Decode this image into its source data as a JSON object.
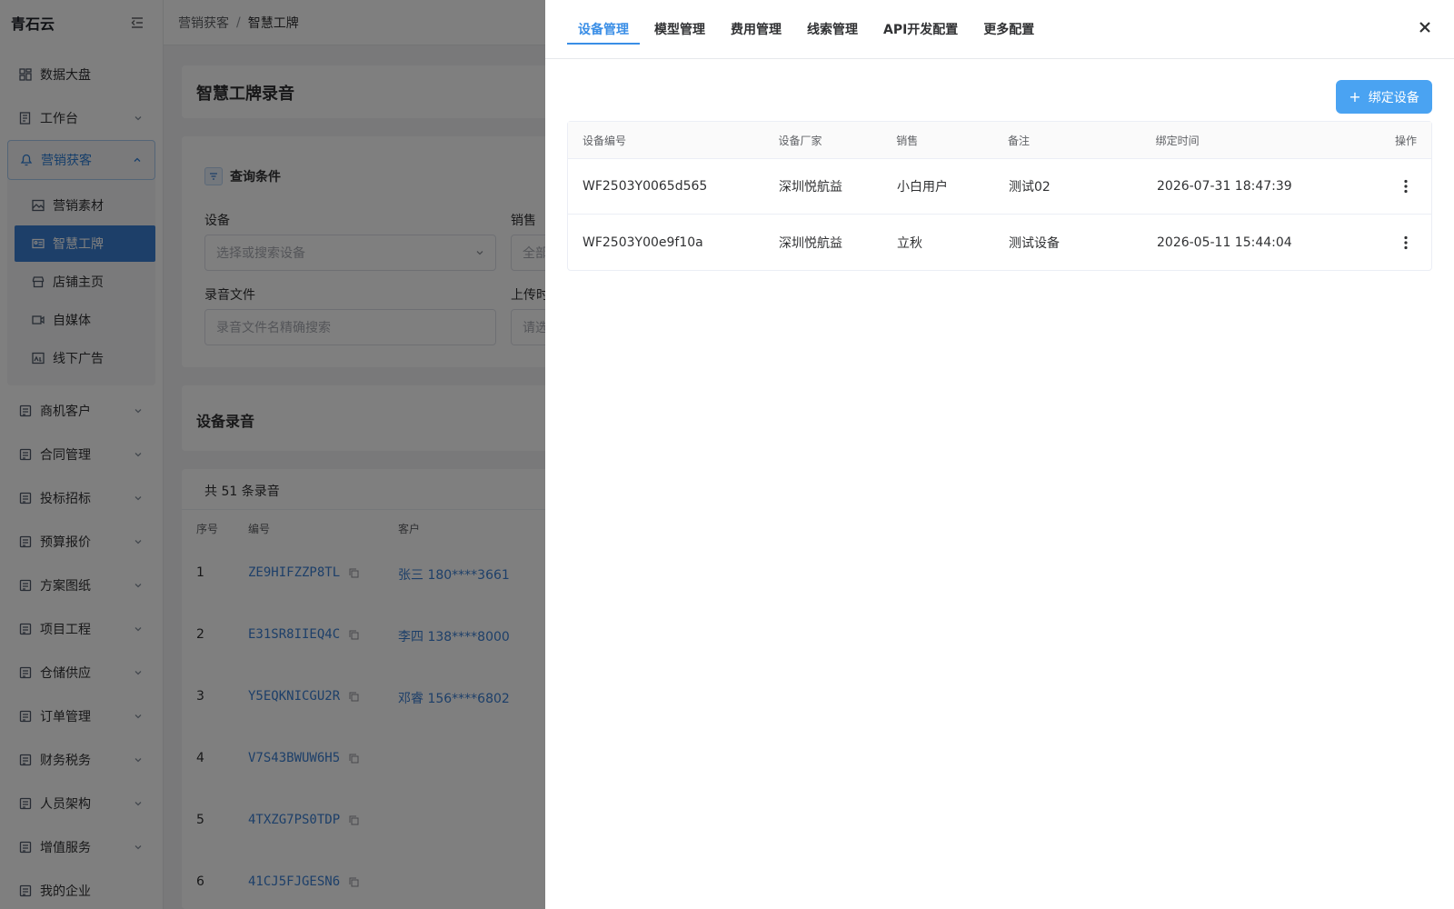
{
  "app": {
    "brand": "青石云"
  },
  "sidebar": {
    "items_top": [
      {
        "label": "数据大盘",
        "icon": "dashboard-icon"
      },
      {
        "label": "工作台",
        "icon": "workbench-icon"
      }
    ],
    "group": {
      "label": "营销获客",
      "icon": "marketing-icon",
      "children": [
        {
          "label": "营销素材",
          "icon": "image-icon"
        },
        {
          "label": "智慧工牌",
          "icon": "badge-icon"
        },
        {
          "label": "店铺主页",
          "icon": "store-icon"
        },
        {
          "label": "自媒体",
          "icon": "video-icon"
        },
        {
          "label": "线下广告",
          "icon": "ad-icon"
        }
      ]
    },
    "items_bottom": [
      {
        "label": "商机客户"
      },
      {
        "label": "合同管理"
      },
      {
        "label": "投标招标"
      },
      {
        "label": "预算报价"
      },
      {
        "label": "方案图纸"
      },
      {
        "label": "项目工程"
      },
      {
        "label": "仓储供应"
      },
      {
        "label": "订单管理"
      },
      {
        "label": "财务税务"
      },
      {
        "label": "人员架构"
      },
      {
        "label": "增值服务"
      },
      {
        "label": "我的企业"
      }
    ]
  },
  "breadcrumb": {
    "parent": "营销获客",
    "current": "智慧工牌",
    "separator": "/"
  },
  "main": {
    "title": "智慧工牌录音",
    "query": {
      "title": "查询条件",
      "device_label": "设备",
      "device_placeholder": "选择或搜索设备",
      "sales_label": "销售",
      "sales_placeholder": "全部",
      "file_label": "录音文件",
      "file_placeholder": "录音文件名精确搜索",
      "upload_label": "上传时",
      "upload_placeholder": "请选"
    },
    "records_title": "设备录音",
    "count_text": "共 51 条录音",
    "columns": {
      "index": "序号",
      "code": "编号",
      "customer": "客户"
    },
    "rows": [
      {
        "index": "1",
        "code": "ZE9HIFZZP8TL",
        "customer": "张三 180****3661"
      },
      {
        "index": "2",
        "code": "E31SR8IIEQ4C",
        "customer": "李四 138****8000"
      },
      {
        "index": "3",
        "code": "Y5EQKNICGU2R",
        "customer": "邓睿 156****6802"
      },
      {
        "index": "4",
        "code": "V7S43BWUW6H5",
        "customer": ""
      },
      {
        "index": "5",
        "code": "4TXZG7PS0TDP",
        "customer": ""
      },
      {
        "index": "6",
        "code": "41CJ5FJGESN6",
        "customer": ""
      }
    ]
  },
  "drawer": {
    "tabs": [
      "设备管理",
      "模型管理",
      "费用管理",
      "线索管理",
      "API开发配置",
      "更多配置"
    ],
    "active_tab": 0,
    "bind_button": "绑定设备",
    "columns": [
      "设备编号",
      "设备厂家",
      "销售",
      "备注",
      "绑定时间",
      "操作"
    ],
    "rows": [
      {
        "id": "WF2503Y0065d565",
        "vendor": "深圳悦航益",
        "sales": "小白用户",
        "note": "测试02",
        "time": "2026-07-31 18:47:39"
      },
      {
        "id": "WF2503Y00e9f10a",
        "vendor": "深圳悦航益",
        "sales": "立秋",
        "note": "测试设备",
        "time": "2026-05-11 15:44:04"
      }
    ]
  },
  "colors": {
    "accent": "#3a8ee6",
    "active_menu": "#3a7fd3",
    "button": "#4aa3f2"
  }
}
